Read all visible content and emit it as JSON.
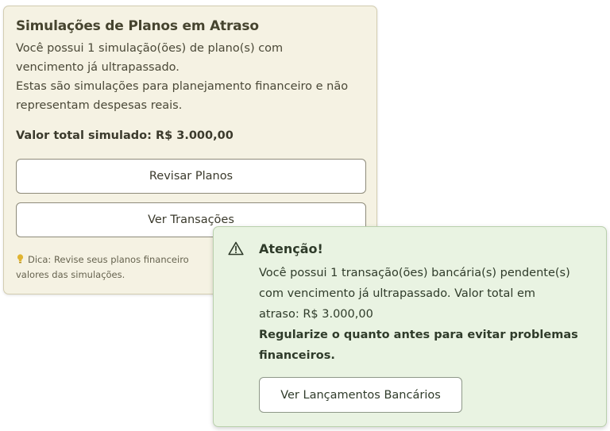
{
  "simulation_card": {
    "title": "Simulações de Planos em Atraso",
    "description_lines": [
      "Você possui 1 simulação(ões) de plano(s) com",
      "vencimento já ultrapassado.",
      "Estas são simulações para planejamento financeiro e não",
      "representam despesas reais."
    ],
    "total_label": "Valor total simulado: R$ 3.000,00",
    "review_button_label": "Revisar Planos",
    "transactions_button_label": "Ver Transações",
    "tip_lines": [
      "Dica: Revise seus planos financeiro",
      "valores das simulações."
    ],
    "tip_icon": "lightbulb-icon"
  },
  "alert_card": {
    "icon": "warning-triangle-icon",
    "title": "Atenção!",
    "message_lines": [
      "Você possui 1 transação(ões) bancária(s) pendente(s)",
      "com vencimento já ultrapassado. Valor total em",
      "atraso: R$ 3.000,00"
    ],
    "emphasis_lines": [
      "Regularize o quanto antes para evitar problemas",
      "financeiros."
    ],
    "button_label": "Ver Lançamentos Bancários"
  },
  "colors": {
    "simulation_bg": "#f5f2e3",
    "alert_bg": "#e9f3e2",
    "tip_icon": "#e0b431"
  }
}
